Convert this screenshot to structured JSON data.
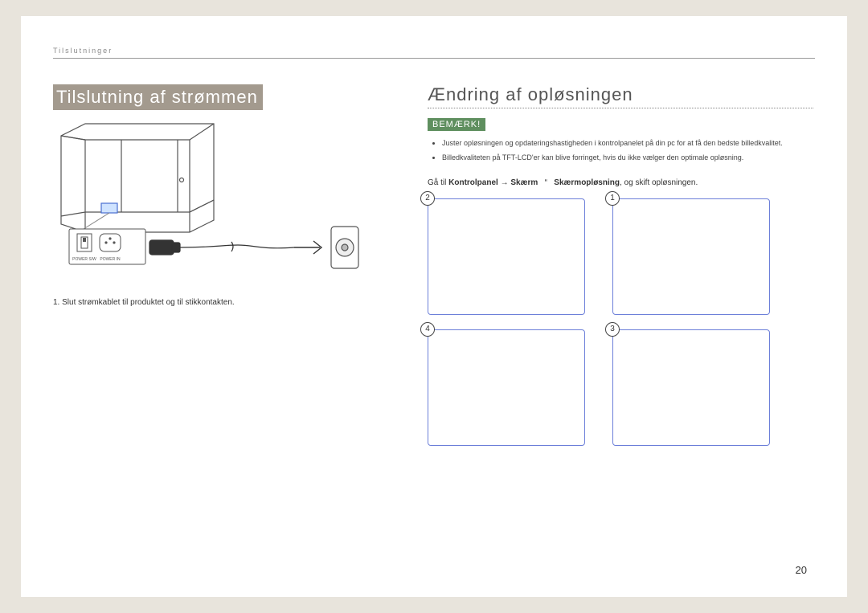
{
  "running_head": "Tilslutninger",
  "page_number": "20",
  "left": {
    "heading": "Tilslutning af strømmen",
    "step1": "1.  Slut strømkablet til produktet og til stikkontakten.",
    "panel": {
      "switch_label": "POWER S/W",
      "in_label": "POWER IN"
    }
  },
  "right": {
    "heading": "Ændring af opløsningen",
    "note_badge": "BEMÆRK!",
    "notes": [
      "Juster opløsningen og opdateringshastigheden i kontrolpanelet på din pc for at få den bedste billedkvalitet.",
      "Billedkvaliteten på TFT-LCD'er kan blive forringet, hvis du ikke vælger den optimale opløsning."
    ],
    "path": {
      "prefix": "Gå til ",
      "control_panel": "Kontrolpanel",
      "arrow": "→",
      "screen": "Skærm",
      "dquote": "“",
      "resolution": "Skærmopløsning",
      "suffix": ", og skift opløsningen."
    },
    "boxes": [
      "2",
      "1",
      "4",
      "3"
    ]
  }
}
